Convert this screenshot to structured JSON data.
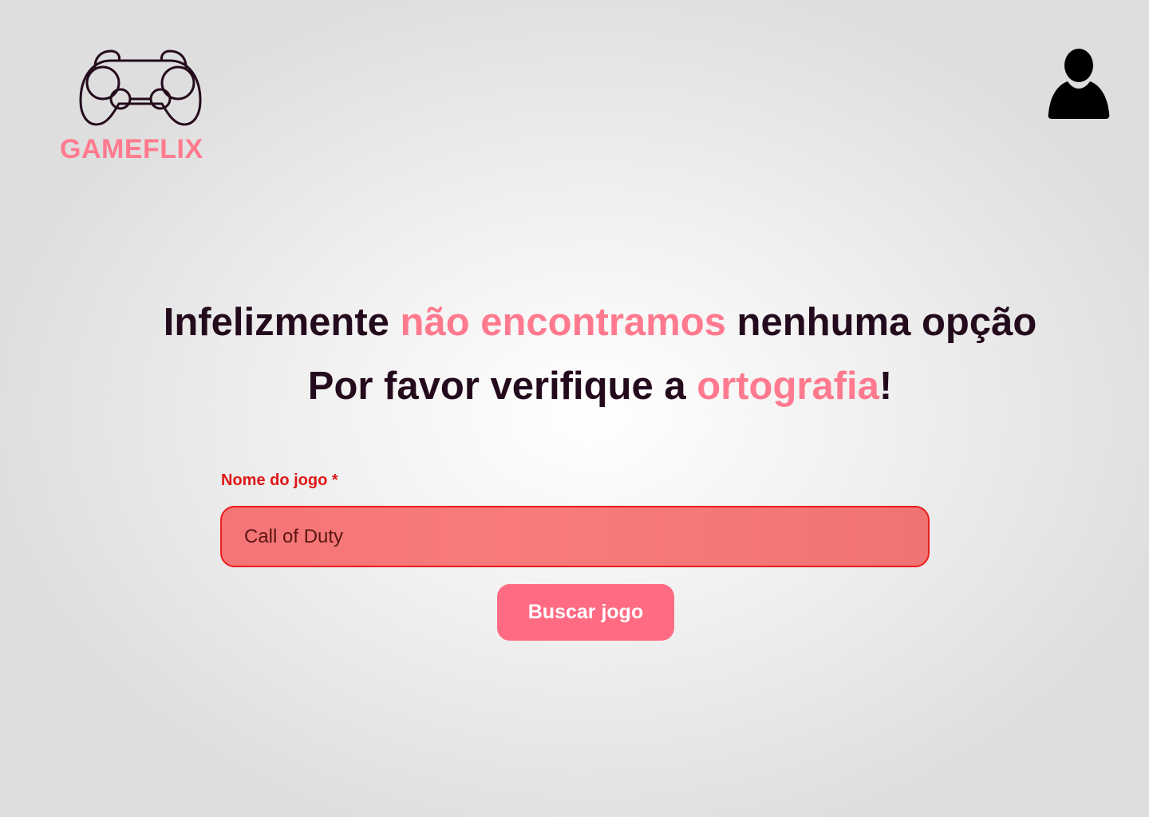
{
  "header": {
    "logo_text": "GAMEFLIX",
    "logo_icon": "gamepad-icon",
    "user_icon": "user-icon"
  },
  "message": {
    "line1_part1": "Infelizmente ",
    "line1_accent": "não encontramos",
    "line1_part2": " nenhuma opção",
    "line2_part1": "Por favor verifique a ",
    "line2_accent": "ortografia",
    "line2_part2": "!"
  },
  "search": {
    "label": "Nome do jogo *",
    "value": "Call of Duty",
    "button_label": "Buscar jogo"
  },
  "colors": {
    "accent": "#ff7a8e",
    "dark_text": "#230a1c",
    "error": "#e01616",
    "input_error_bg": "#f47575",
    "button": "#ff6b83"
  }
}
